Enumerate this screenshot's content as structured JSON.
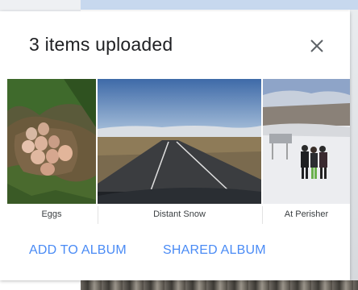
{
  "dialog": {
    "title": "3 items uploaded",
    "close_icon": "close-icon"
  },
  "items": [
    {
      "label": "Eggs"
    },
    {
      "label": "Distant Snow"
    },
    {
      "label": "At Perisher"
    }
  ],
  "actions": {
    "add_to_album": "ADD TO ALBUM",
    "shared_album": "SHARED ALBUM"
  },
  "colors": {
    "accent": "#4a8bf5",
    "title_text": "#202124"
  }
}
